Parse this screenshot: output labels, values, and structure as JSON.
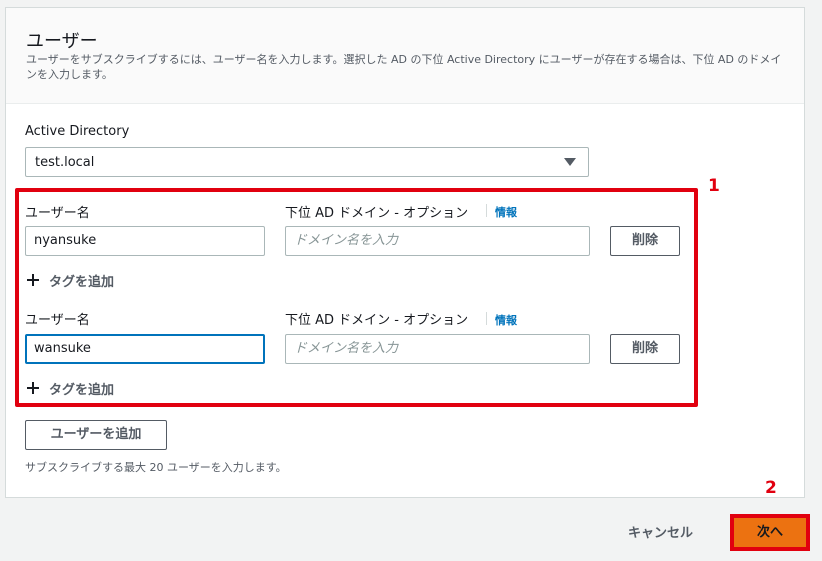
{
  "header": {
    "title": "ユーザー",
    "description": "ユーザーをサブスクライブするには、ユーザー名を入力します。選択した AD の下位 Active Directory にユーザーが存在する場合は、下位 AD のドメインを入力します。"
  },
  "directory": {
    "label": "Active Directory",
    "selected": "test.local"
  },
  "users": [
    {
      "username_label": "ユーザー名",
      "username_value": "nyansuke",
      "domain_label": "下位 AD ドメイン - オプション",
      "info_link": "情報",
      "domain_placeholder": "ドメイン名を入力",
      "remove_label": "削除",
      "add_tag_label": "タグを追加"
    },
    {
      "username_label": "ユーザー名",
      "username_value": "wansuke",
      "domain_label": "下位 AD ドメイン - オプション",
      "info_link": "情報",
      "domain_placeholder": "ドメイン名を入力",
      "remove_label": "削除",
      "add_tag_label": "タグを追加"
    }
  ],
  "add_user_label": "ユーザーを追加",
  "hint": "サブスクライブする最大 20 ユーザーを入力します。",
  "annotations": {
    "step1": "1",
    "step2": "2"
  },
  "footer": {
    "cancel_label": "キャンセル",
    "next_label": "次へ"
  },
  "colors": {
    "accent": "#ec7211",
    "link": "#0073bb",
    "annotation": "#e1000f"
  }
}
